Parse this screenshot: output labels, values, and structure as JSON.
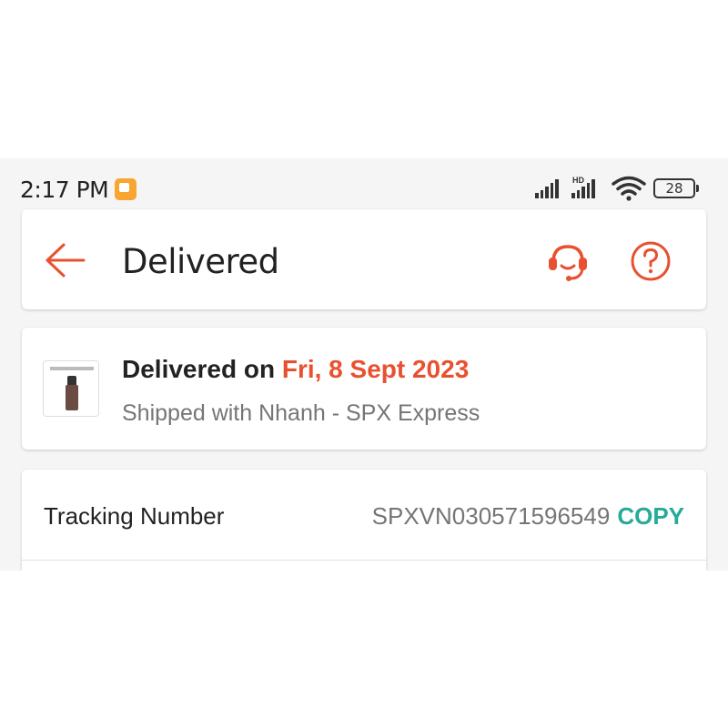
{
  "status_bar": {
    "time": "2:17 PM",
    "network_label": "HD",
    "battery": "28"
  },
  "header": {
    "title": "Delivered",
    "accent_color": "#e8512f"
  },
  "delivery": {
    "prefix": "Delivered on ",
    "date": "Fri, 8 Sept 2023",
    "shipped_with": "Shipped with Nhanh - SPX Express"
  },
  "tracking": {
    "label": "Tracking Number",
    "number": "SPXVN030571596549",
    "copy_label": "COPY",
    "copy_color": "#26aa99"
  },
  "icons": [
    "back-arrow-icon",
    "headset-icon",
    "help-icon",
    "signal-icon",
    "wifi-icon",
    "battery-icon",
    "notification-icon"
  ]
}
